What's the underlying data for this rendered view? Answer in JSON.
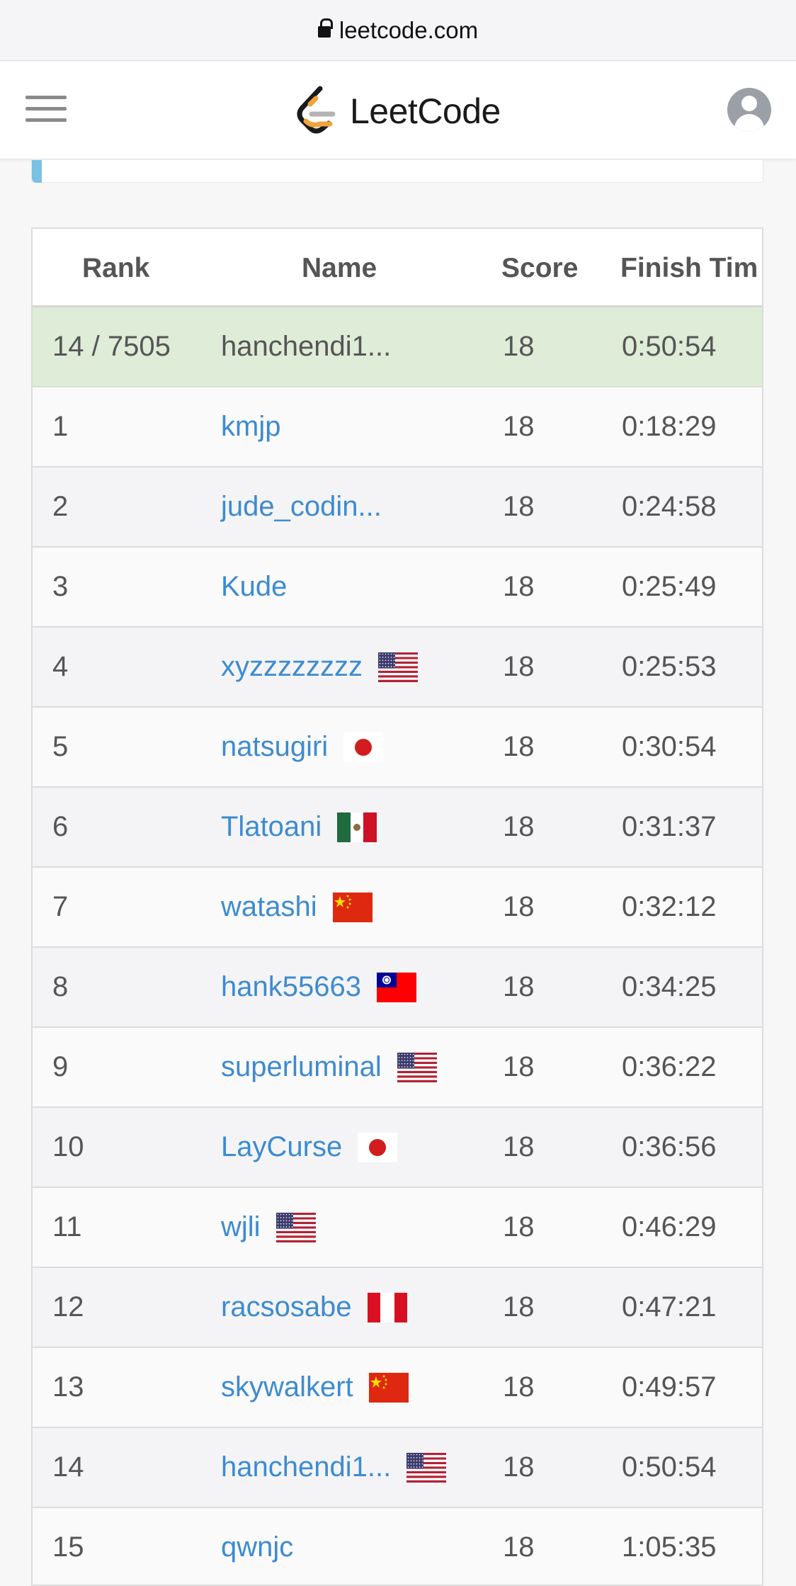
{
  "browser": {
    "url": "leetcode.com"
  },
  "header": {
    "logo_text": "LeetCode"
  },
  "table": {
    "columns": [
      "Rank",
      "Name",
      "Score",
      "Finish Tim"
    ],
    "my_row": {
      "rank": "14 / 7505",
      "name": "hanchendi1...",
      "score": "18",
      "finish_time": "0:50:54"
    },
    "rows": [
      {
        "rank": "1",
        "name": "kmjp",
        "flag": "",
        "score": "18",
        "finish_time": "0:18:29"
      },
      {
        "rank": "2",
        "name": "jude_codin...",
        "flag": "",
        "score": "18",
        "finish_time": "0:24:58"
      },
      {
        "rank": "3",
        "name": "Kude",
        "flag": "",
        "score": "18",
        "finish_time": "0:25:49"
      },
      {
        "rank": "4",
        "name": "xyzzzzzzzz",
        "flag": "us-flag-icon",
        "score": "18",
        "finish_time": "0:25:53"
      },
      {
        "rank": "5",
        "name": "natsugiri",
        "flag": "jp-flag-icon",
        "score": "18",
        "finish_time": "0:30:54"
      },
      {
        "rank": "6",
        "name": "Tlatoani",
        "flag": "mx-flag-icon",
        "score": "18",
        "finish_time": "0:31:37"
      },
      {
        "rank": "7",
        "name": "watashi",
        "flag": "cn-flag-icon",
        "score": "18",
        "finish_time": "0:32:12"
      },
      {
        "rank": "8",
        "name": "hank55663",
        "flag": "tw-flag-icon",
        "score": "18",
        "finish_time": "0:34:25"
      },
      {
        "rank": "9",
        "name": "superluminal",
        "flag": "us-flag-icon",
        "score": "18",
        "finish_time": "0:36:22"
      },
      {
        "rank": "10",
        "name": "LayCurse",
        "flag": "jp-flag-icon",
        "score": "18",
        "finish_time": "0:36:56"
      },
      {
        "rank": "11",
        "name": "wjli",
        "flag": "us-flag-icon",
        "score": "18",
        "finish_time": "0:46:29"
      },
      {
        "rank": "12",
        "name": "racsosabe",
        "flag": "pe-flag-icon",
        "score": "18",
        "finish_time": "0:47:21"
      },
      {
        "rank": "13",
        "name": "skywalkert",
        "flag": "cn-flag-icon",
        "score": "18",
        "finish_time": "0:49:57"
      },
      {
        "rank": "14",
        "name": "hanchendi1...",
        "flag": "us-flag-icon",
        "score": "18",
        "finish_time": "0:50:54"
      },
      {
        "rank": "15",
        "name": "qwnjc",
        "flag": "",
        "score": "18",
        "finish_time": "1:05:35"
      }
    ]
  },
  "colors": {
    "link": "#3d8bd0",
    "highlight_row": "#dfecd7",
    "logo_orange": "#f0a33a",
    "accent": "#7cc0e3"
  }
}
